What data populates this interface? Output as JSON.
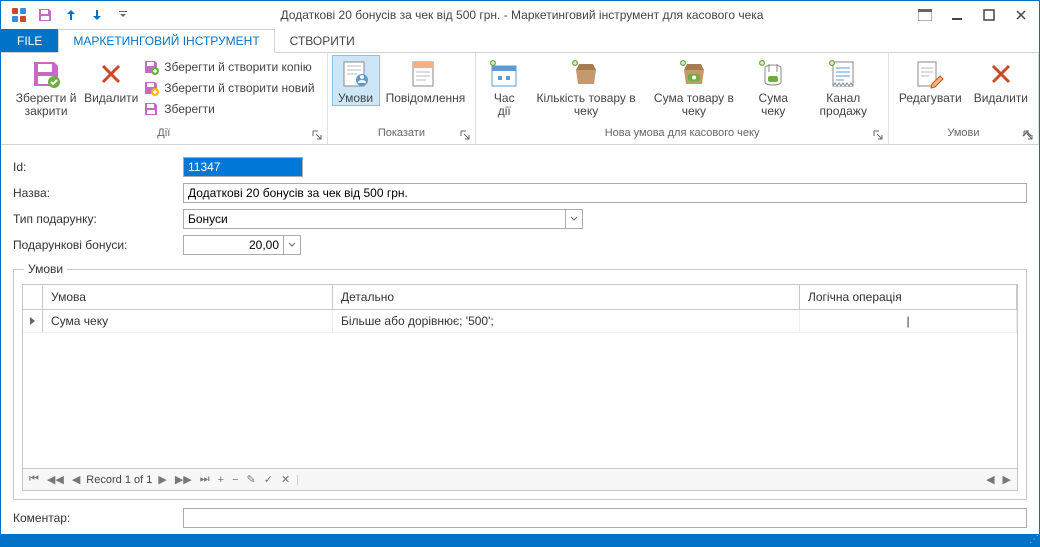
{
  "title": "Додаткові 20 бонусів за чек від 500 грн. - Маркетинговий інструмент для касового чека",
  "tabs": {
    "file": "FILE",
    "main": "МАРКЕТИНГОВИЙ ІНСТРУМЕНТ",
    "create": "СТВОРИТИ"
  },
  "ribbon": {
    "actions": {
      "save_close": "Зберегти й закрити",
      "delete": "Видалити",
      "save_copy": "Зберегти й створити копію",
      "save_new": "Зберегти й створити новий",
      "save": "Зберегти",
      "group": "Дії"
    },
    "show": {
      "conditions": "Умови",
      "notification": "Повідомлення",
      "group": "Показати"
    },
    "newcond": {
      "time": "Час дії",
      "qty": "Кількість товару в чеку",
      "sum_item": "Сума товару в чеку",
      "sum_check": "Сума чеку",
      "channel": "Канал продажу",
      "group": "Нова умова для касового чеку"
    },
    "conds": {
      "edit": "Редагувати",
      "delete": "Видалити",
      "group": "Умови"
    }
  },
  "form": {
    "id_label": "Id:",
    "id_value": "11347",
    "name_label": "Назва:",
    "name_value": "Додаткові 20 бонусів за чек від 500 грн.",
    "gift_type_label": "Тип подарунку:",
    "gift_type_value": "Бонуси",
    "gift_bonus_label": "Подарункові бонуси:",
    "gift_bonus_value": "20,00",
    "conditions_group": "Умови",
    "comment_label": "Коментар:",
    "comment_value": ""
  },
  "grid": {
    "col1": "Умова",
    "col2": "Детально",
    "col3": "Логічна операція",
    "rows": [
      {
        "cond": "Сума чеку",
        "detail": "Більше або дорівнює;  '500';",
        "op": "|"
      }
    ],
    "navigator": "Record 1 of 1"
  }
}
